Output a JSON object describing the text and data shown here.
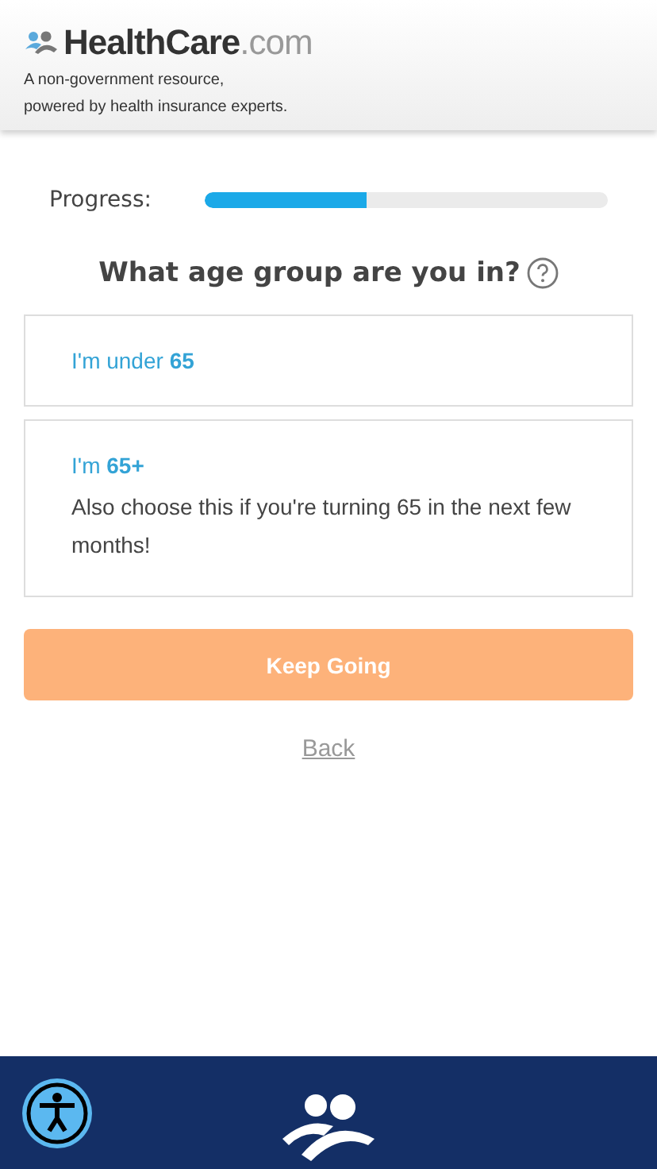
{
  "header": {
    "logo": "**HealthCare**.com",
    "tagline_lines": [
      "A non-government resource,",
      "powered by health insurance experts."
    ]
  },
  "progress": {
    "label": "Progress:",
    "level": 0.4
  },
  "question": "What age group are you in?",
  "options": [
    {
      "title": "I'm under **65**",
      "selected": false
    },
    {
      "title": "I'm **65+**",
      "detail": "Also choose this if you're turning 65 in the next few months!",
      "selected": false
    }
  ],
  "primary_button": {
    "label": "Keep Going",
    "disabled": true
  },
  "back_link": "Back"
}
